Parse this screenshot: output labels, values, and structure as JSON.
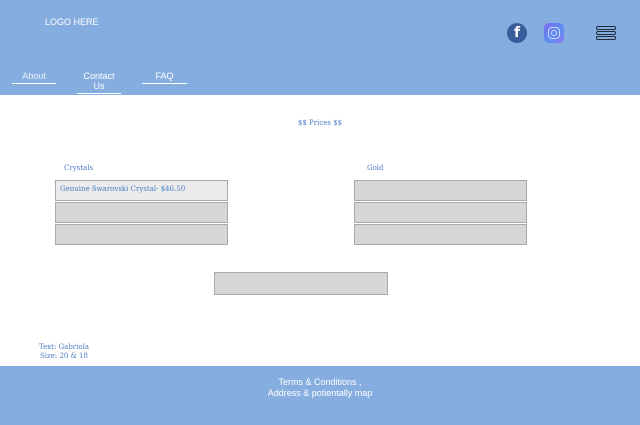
{
  "header": {
    "logo": "LOGO HERE",
    "social": {
      "facebook_glyph": "f",
      "facebook_icon": "facebook-icon",
      "instagram_icon": "instagram-icon",
      "menu_icon": "hamburger-menu-icon"
    },
    "nav": [
      {
        "label": "About"
      },
      {
        "label": "Contact Us"
      },
      {
        "label": "FAQ"
      }
    ]
  },
  "main": {
    "heading": "$$ Prices $$",
    "columns": [
      {
        "label": "Crystals",
        "rows": [
          "Genuine Swarovski Crystal- $46.50",
          "",
          ""
        ]
      },
      {
        "label": "Gold",
        "rows": [
          "",
          "",
          ""
        ]
      }
    ],
    "note": {
      "line1": "Text: Gabriola",
      "line2": "Size: 20 & 18"
    }
  },
  "footer": {
    "line1": "Terms & Conditions ,",
    "line2": "Address & potientally map"
  },
  "colors": {
    "header_bg": "#86addf",
    "accent_text": "#4a7cc4",
    "cell_bg": "#d6d6d6",
    "cell_highlight_bg": "#ebebeb"
  }
}
